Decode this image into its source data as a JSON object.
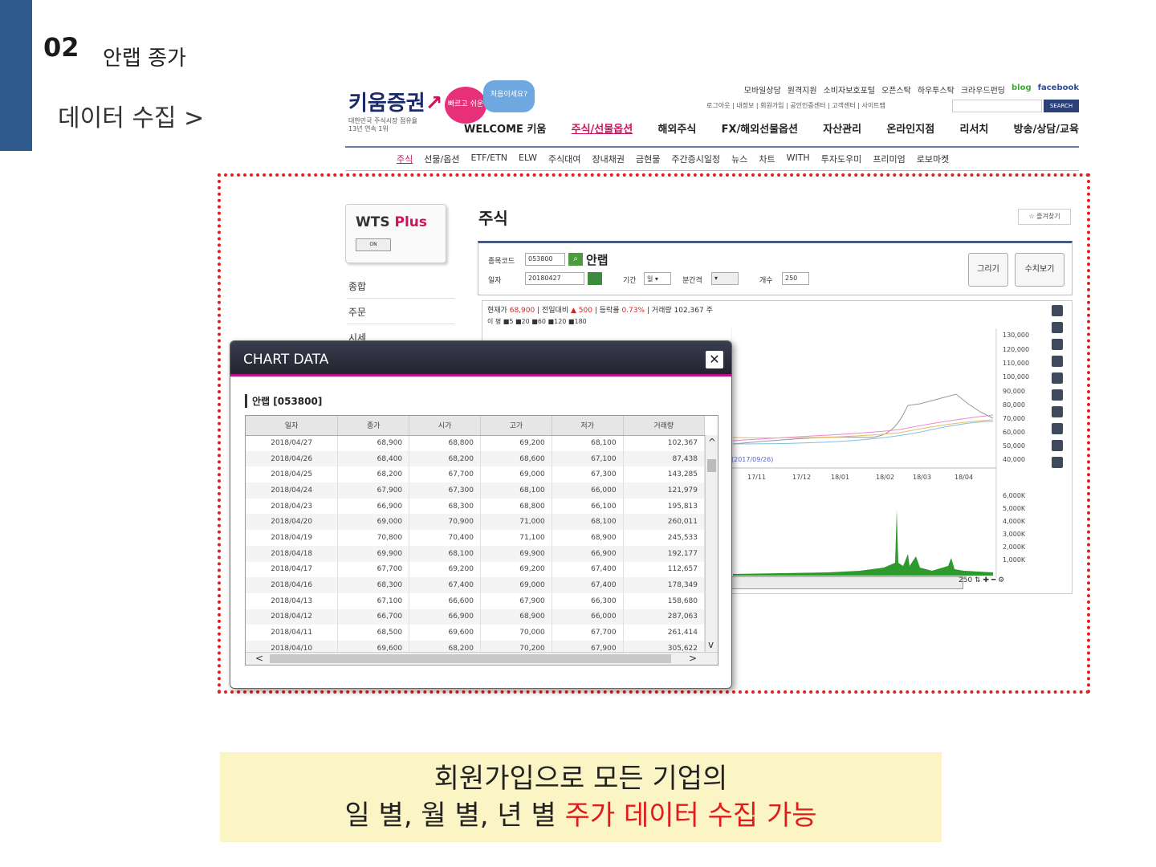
{
  "slide": {
    "number": "02",
    "title": "안랩 종가",
    "subtitle": "데이터 수집 >",
    "caption_line1": "회원가입으로 모든 기업의",
    "caption_line2_normal": "일 별, 월 별, 년 별 ",
    "caption_line2_highlight": "주가 데이터 수집 가능"
  },
  "site": {
    "logo": "키움증권",
    "logo_sub1": "대한민국 주식시장 점유율",
    "logo_sub2": "13년 연속 1위",
    "bubble1": "빠르고 쉬운",
    "bubble2": "처음이세요?",
    "welcome": "WELCOME 키움",
    "top_links": [
      "모바일상담",
      "원격지원",
      "소비자보호포털",
      "오픈스탁",
      "하우투스탁",
      "크라우드펀딩"
    ],
    "blog": "blog",
    "facebook": "facebook",
    "util_links": "로그아웃 | 내정보 | 회원가입 | 공인인증센터 | 고객센터 | 사이트맵",
    "search_btn": "SEARCH",
    "gnb": [
      "주식/선물옵션",
      "해외주식",
      "FX/해외선물옵션",
      "자산관리",
      "온라인지점",
      "리서치",
      "방송/상담/교육"
    ],
    "lnb": [
      "주식",
      "선물/옵션",
      "ETF/ETN",
      "ELW",
      "주식대여",
      "장내채권",
      "금현물",
      "주간증시일정",
      "뉴스",
      "차트",
      "WITH",
      "투자도우미",
      "프리미엄",
      "로보마켓"
    ]
  },
  "wts": {
    "label": "WTS",
    "plus": "Plus",
    "btn": "ON"
  },
  "side_menu": [
    "종합",
    "주문",
    "시세"
  ],
  "stock_panel": {
    "title": "주식",
    "fav": "즐겨찾기",
    "code_label": "종목코드",
    "code_value": "053800",
    "name": "안랩",
    "date_label": "일자",
    "date_value": "20180427",
    "period_label": "기간",
    "period_value": "일",
    "minute_label": "분간격",
    "count_label": "개수",
    "count_value": "250",
    "btn_draw": "그리기",
    "btn_values": "수치보기"
  },
  "chart": {
    "info_current_label": "현재가",
    "info_current": "68,900",
    "info_change_label": "전일대비",
    "info_change": "▲ 500",
    "info_rate_label": "등락률",
    "info_rate": "0.73%",
    "info_volume_label": "거래량",
    "info_volume": "102,367 주",
    "legend": "이 평 ■5 ■20 ■60 ■120 ■180",
    "price_ticks": [
      "130,000",
      "120,000",
      "110,000",
      "100,000",
      "90,000",
      "80,000",
      "70,000",
      "60,000",
      "50,000",
      "40,000"
    ],
    "date_ticks": [
      "17/11",
      "17/12",
      "18/01",
      "18/02",
      "18/03",
      "18/04"
    ],
    "low_label": "(2017/09/26)",
    "volume_ticks": [
      "6,000K",
      "5,000K",
      "4,000K",
      "3,000K",
      "2,000K",
      "1,000K"
    ],
    "zoom_value": "250"
  },
  "dialog": {
    "title": "CHART DATA",
    "close": "✕",
    "stock_label": "안랩 [053800]",
    "columns": [
      "일자",
      "종가",
      "시가",
      "고가",
      "저가",
      "거래량"
    ],
    "rows": [
      [
        "2018/04/27",
        "68,900",
        "68,800",
        "69,200",
        "68,100",
        "102,367"
      ],
      [
        "2018/04/26",
        "68,400",
        "68,200",
        "68,600",
        "67,100",
        "87,438"
      ],
      [
        "2018/04/25",
        "68,200",
        "67,700",
        "69,000",
        "67,300",
        "143,285"
      ],
      [
        "2018/04/24",
        "67,900",
        "67,300",
        "68,100",
        "66,000",
        "121,979"
      ],
      [
        "2018/04/23",
        "66,900",
        "68,300",
        "68,800",
        "66,100",
        "195,813"
      ],
      [
        "2018/04/20",
        "69,000",
        "70,900",
        "71,000",
        "68,100",
        "260,011"
      ],
      [
        "2018/04/19",
        "70,800",
        "70,400",
        "71,100",
        "68,900",
        "245,533"
      ],
      [
        "2018/04/18",
        "69,900",
        "68,100",
        "69,900",
        "66,900",
        "192,177"
      ],
      [
        "2018/04/17",
        "67,700",
        "69,200",
        "69,200",
        "67,400",
        "112,657"
      ],
      [
        "2018/04/16",
        "68,300",
        "67,400",
        "69,000",
        "67,400",
        "178,349"
      ],
      [
        "2018/04/13",
        "67,100",
        "66,600",
        "67,900",
        "66,300",
        "158,680"
      ],
      [
        "2018/04/12",
        "66,700",
        "66,900",
        "68,900",
        "66,000",
        "287,063"
      ],
      [
        "2018/04/11",
        "68,500",
        "69,600",
        "70,000",
        "67,700",
        "261,414"
      ],
      [
        "2018/04/10",
        "69,600",
        "68,200",
        "70,200",
        "67,900",
        "305,622"
      ]
    ]
  }
}
